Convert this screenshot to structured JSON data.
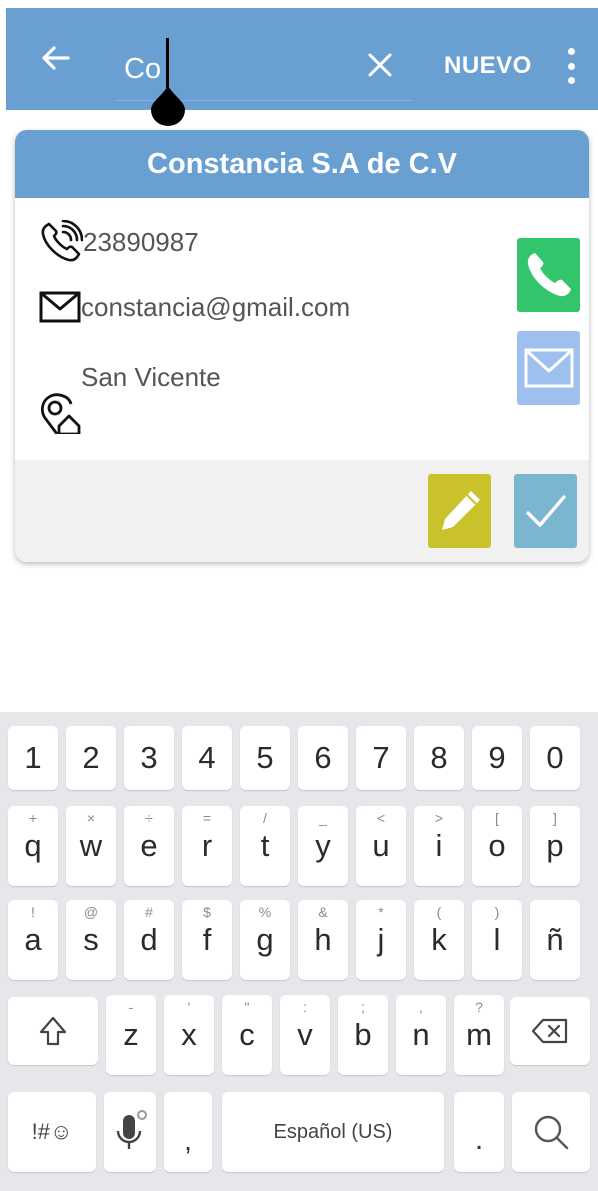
{
  "appbar": {
    "search_value": "Co",
    "new_label": "NUEVO",
    "color": "#6a9fd2"
  },
  "card": {
    "title": "Constancia S.A de C.V",
    "phone": "23890987",
    "email": "constancia@gmail.com",
    "address": "San Vicente",
    "colors": {
      "call": "#33c56c",
      "mail": "#9dc0ee",
      "edit": "#c9c22b",
      "confirm": "#7ab6cf"
    }
  },
  "keyboard": {
    "numbers": [
      "1",
      "2",
      "3",
      "4",
      "5",
      "6",
      "7",
      "8",
      "9",
      "0"
    ],
    "row1": [
      {
        "k": "q",
        "s": "+"
      },
      {
        "k": "w",
        "s": "×"
      },
      {
        "k": "e",
        "s": "÷"
      },
      {
        "k": "r",
        "s": "="
      },
      {
        "k": "t",
        "s": "/"
      },
      {
        "k": "y",
        "s": "_"
      },
      {
        "k": "u",
        "s": "<"
      },
      {
        "k": "i",
        "s": ">"
      },
      {
        "k": "o",
        "s": "["
      },
      {
        "k": "p",
        "s": "]"
      }
    ],
    "row2": [
      {
        "k": "a",
        "s": "!"
      },
      {
        "k": "s",
        "s": "@"
      },
      {
        "k": "d",
        "s": "#"
      },
      {
        "k": "f",
        "s": "$"
      },
      {
        "k": "g",
        "s": "%"
      },
      {
        "k": "h",
        "s": "&"
      },
      {
        "k": "j",
        "s": "*"
      },
      {
        "k": "k",
        "s": "("
      },
      {
        "k": "l",
        "s": ")"
      },
      {
        "k": "ñ",
        "s": ""
      }
    ],
    "row3": [
      {
        "k": "z",
        "s": "-"
      },
      {
        "k": "x",
        "s": "'"
      },
      {
        "k": "c",
        "s": "\""
      },
      {
        "k": "v",
        "s": ":"
      },
      {
        "k": "b",
        "s": ";"
      },
      {
        "k": "n",
        "s": ","
      },
      {
        "k": "m",
        "s": "?"
      }
    ],
    "symbols_label": "!#☺",
    "comma": ",",
    "space_label": "Español (US)",
    "period": "."
  }
}
